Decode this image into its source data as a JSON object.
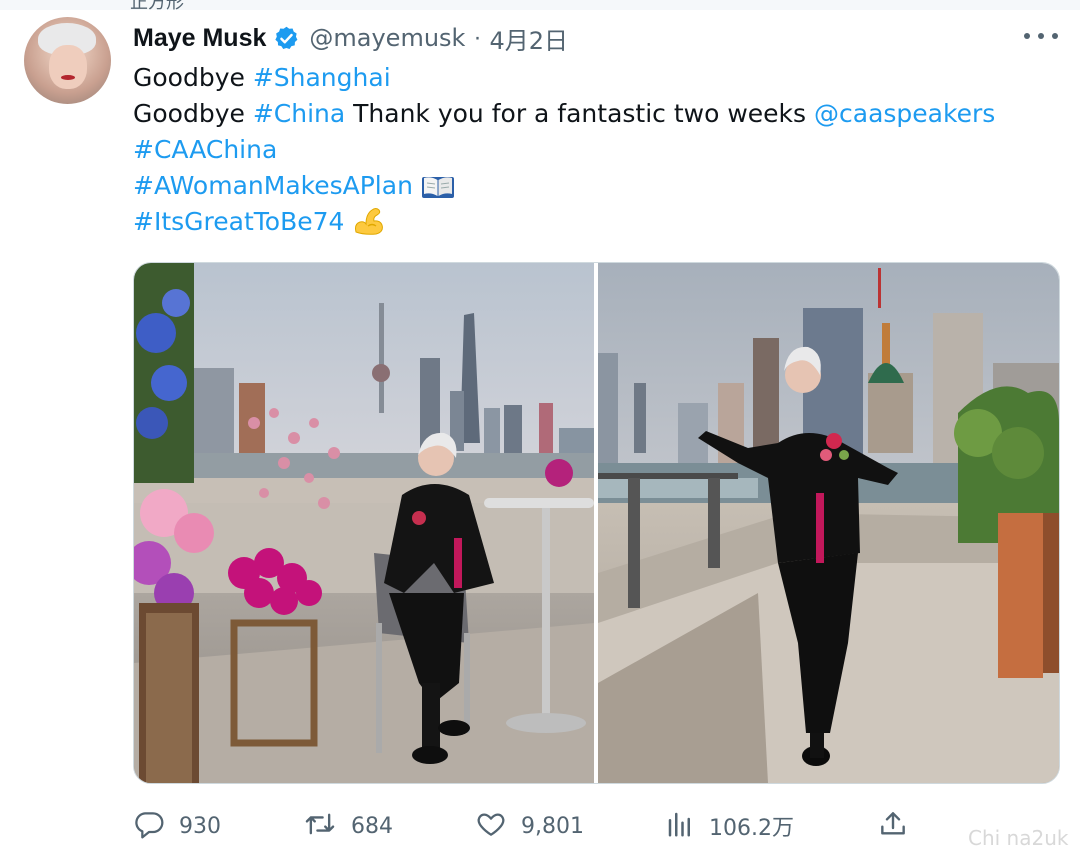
{
  "top_cutoff_text": "正方形",
  "tweet": {
    "author_name": "Maye Musk",
    "handle": "@mayemusk",
    "separator": "·",
    "date": "4月2日",
    "lines": [
      [
        "Goodbye ",
        "#Shanghai"
      ],
      [
        "Goodbye ",
        "#China",
        " Thank you for a fantastic two weeks ",
        "@caaspeakers"
      ],
      [
        "#CAAChina"
      ],
      [
        "#AWomanMakesAPlan"
      ],
      [
        "#ItsGreatToBe74"
      ]
    ],
    "line_icons": {
      "line4": "open-book-emoji",
      "line5": "flexed-biceps-emoji"
    }
  },
  "actions": {
    "reply_count": "930",
    "retweet_count": "684",
    "like_count": "9,801",
    "views_count": "106.2万"
  },
  "icons": {
    "verified": "verified-badge-icon",
    "more": "more-icon",
    "reply": "reply-icon",
    "retweet": "retweet-icon",
    "like": "heart-icon",
    "views": "views-icon",
    "share": "share-icon"
  },
  "colors": {
    "link": "#1d9bf0",
    "secondary": "#536471",
    "text": "#0f1419"
  },
  "watermark": "Chi na2uk"
}
